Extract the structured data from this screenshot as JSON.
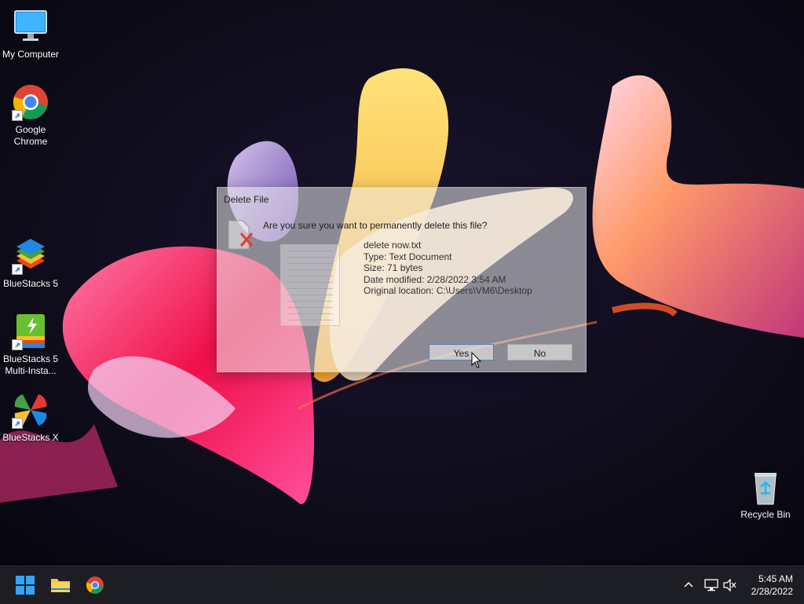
{
  "desktop": {
    "icons": [
      {
        "label": "My Computer"
      },
      {
        "label": "Google\nChrome"
      },
      {
        "label": "BlueStacks 5"
      },
      {
        "label": "BlueStacks 5\nMulti-Insta..."
      },
      {
        "label": "BlueStacks X"
      },
      {
        "label": "Recycle Bin"
      }
    ]
  },
  "dialog": {
    "title": "Delete File",
    "question": "Are you sure you want to permanently delete this file?",
    "file_name": "delete now.txt",
    "type": "Type: Text Document",
    "size": "Size: 71 bytes",
    "date_modified": "Date modified: 2/28/2022 3:54 AM",
    "original_location": "Original location: C:\\Users\\VM6\\Desktop",
    "yes_label": "Yes",
    "no_label": "No"
  },
  "taskbar": {
    "time": "5:45 AM",
    "date": "2/28/2022"
  },
  "colors": {
    "taskbar_bg": "#1d1d24",
    "accent": "#1a7fe0"
  }
}
